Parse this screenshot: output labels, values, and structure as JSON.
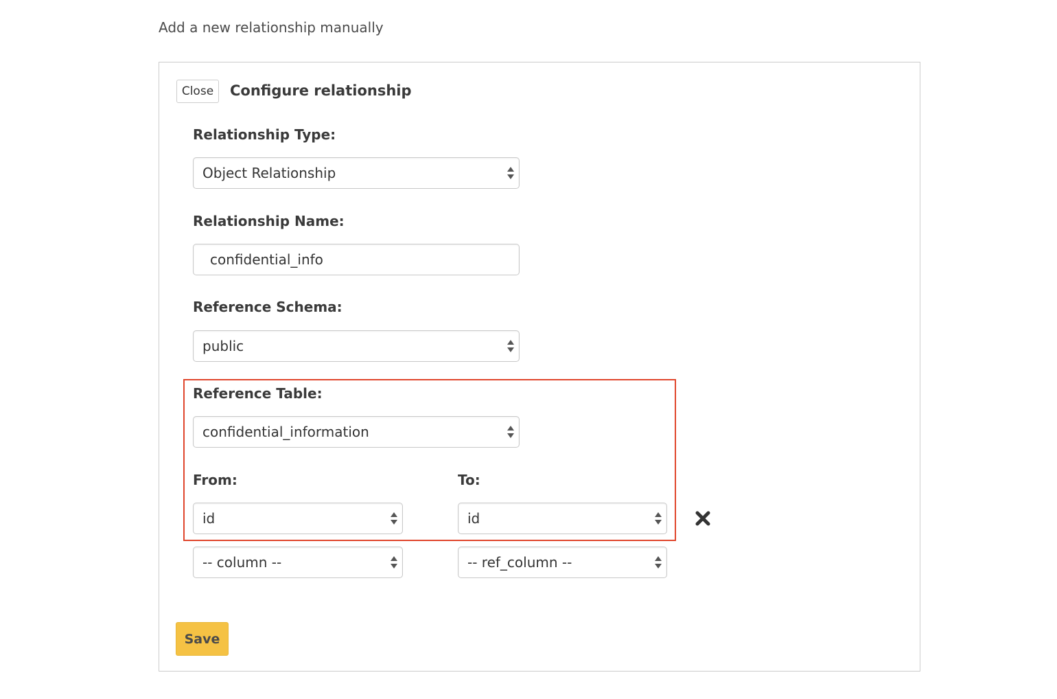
{
  "page": {
    "heading": "Add a new relationship manually"
  },
  "panel": {
    "close_label": "Close",
    "title": "Configure relationship"
  },
  "form": {
    "relationship_type": {
      "label": "Relationship Type:",
      "value": "Object Relationship"
    },
    "relationship_name": {
      "label": "Relationship Name:",
      "value": "confidential_info"
    },
    "reference_schema": {
      "label": "Reference Schema:",
      "value": "public"
    },
    "reference_table": {
      "label": "Reference Table:",
      "value": "confidential_information"
    },
    "mapping": {
      "from_label": "From:",
      "to_label": "To:",
      "rows": [
        {
          "from": "id",
          "to": "id"
        },
        {
          "from": "-- column --",
          "to": "-- ref_column --"
        }
      ]
    },
    "save_label": "Save"
  },
  "colors": {
    "highlight": "#e0452b",
    "save_button": "#f5c244"
  },
  "icons": {
    "select_arrows": "select-arrows-icon",
    "remove": "close-x-icon"
  }
}
